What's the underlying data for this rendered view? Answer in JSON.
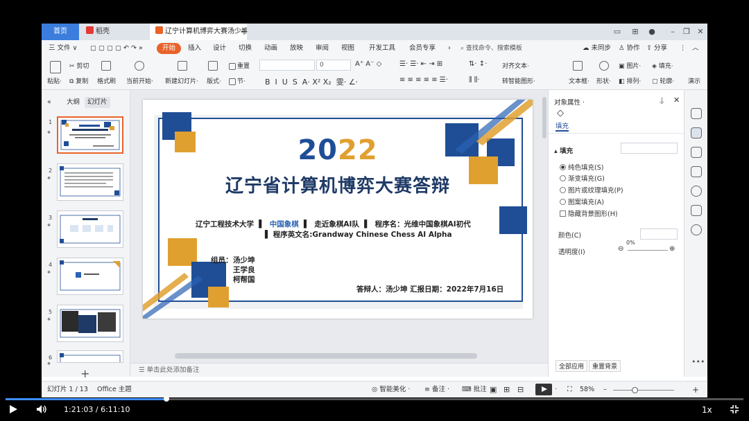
{
  "titlebar": {
    "tabs": [
      {
        "label": "首页"
      },
      {
        "label": "稻壳"
      },
      {
        "label": "辽宁计算机博弈大赛汤少坤"
      }
    ]
  },
  "menubar": {
    "file": "三 文件 ∨",
    "items": [
      "开始",
      "插入",
      "设计",
      "切换",
      "动画",
      "放映",
      "审阅",
      "视图",
      "开发工具",
      "会员专享"
    ],
    "search_placeholder": "查找命令、搜索模板",
    "unsynced": "未同步",
    "collab": "协作",
    "share": "分享"
  },
  "ribbon": {
    "paste": "粘贴·",
    "cut": "剪切",
    "copy": "复制",
    "format_painter": "格式刷",
    "current_start": "当前开始·",
    "new_slide": "新建幻灯片·",
    "layout": "版式·",
    "reset": "重置",
    "section": "节·",
    "font_size": "0",
    "align_text": "对齐文本·",
    "convert_smartart": "转智能图形·",
    "textbox": "文本框·",
    "shape": "形状·",
    "picture": "图片·",
    "fill": "填充·",
    "arrange": "排列·",
    "outline": "轮廓·",
    "present": "演示"
  },
  "leftpanel": {
    "outline_tab": "大纲",
    "slides_tab": "幻灯片",
    "slide_numbers": [
      "1",
      "2",
      "3",
      "4",
      "5",
      "6"
    ]
  },
  "slide": {
    "year_a": "20",
    "year_b": "22",
    "title": "辽宁省计算机博弈大赛答辩",
    "line1_a": "辽宁工程技术大学",
    "line1_b": "中国象棋",
    "line1_c": "走近象棋AI队",
    "line1_d": "程序名：光维中国象棋AI初代",
    "line2": "程序英文名:Grandway Chinese Chess AI Alpha",
    "members_label": "组员：",
    "members": [
      "汤少坤",
      "王学良",
      "柯帮国"
    ],
    "footer": "答辩人：汤少坤  汇报日期：2022年7月16日",
    "colors": {
      "navy": "#1f4e96",
      "gold": "#e0a030",
      "blue": "#2a63b4"
    }
  },
  "notes_placeholder": "单击此处添加备注",
  "rightpanel": {
    "title": "对象属性 ·",
    "fill_tab": "填充",
    "fill_header": "填充",
    "options": [
      "纯色填充(S)",
      "渐变填充(G)",
      "图片或纹理填充(P)",
      "图案填充(A)"
    ],
    "hide_bg": "隐藏背景图形(H)",
    "color_label": "颜色(C)",
    "transparency_label": "透明度(I)",
    "transparency_value": "0%",
    "apply_all": "全部应用",
    "reset_bg": "重置背景"
  },
  "statusbar": {
    "slide_pos": "幻灯片 1 / 13",
    "theme": "Office 主题",
    "smart_beautify": "智能美化 ·",
    "notes": "备注 ·",
    "comments": "批注",
    "zoom": "58%",
    "zoom_fraction": 0.35
  },
  "player": {
    "time": "1:21:03 / 6:11:10",
    "progress": 0.218,
    "speed": "1x"
  }
}
